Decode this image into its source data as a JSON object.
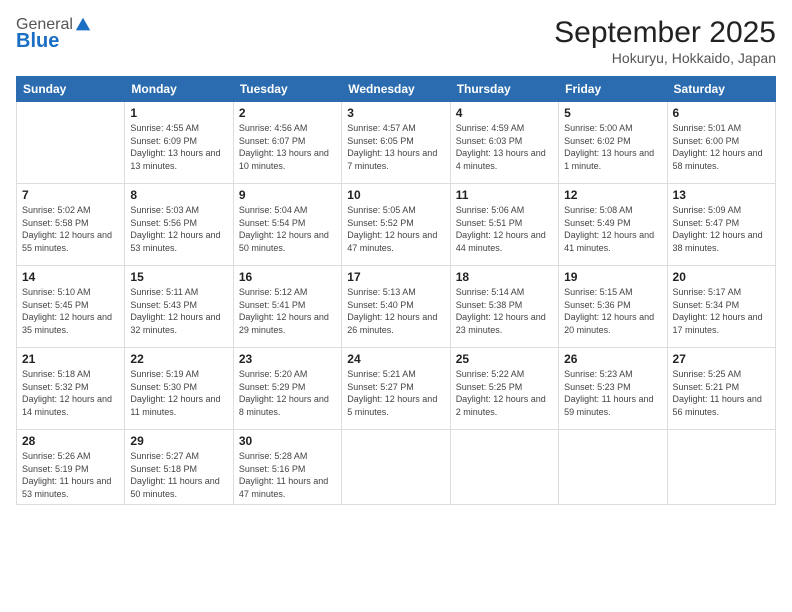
{
  "header": {
    "logo_general": "General",
    "logo_blue": "Blue",
    "month_title": "September 2025",
    "location": "Hokuryu, Hokkaido, Japan"
  },
  "days_of_week": [
    "Sunday",
    "Monday",
    "Tuesday",
    "Wednesday",
    "Thursday",
    "Friday",
    "Saturday"
  ],
  "weeks": [
    [
      {
        "day": "",
        "sunrise": "",
        "sunset": "",
        "daylight": ""
      },
      {
        "day": "1",
        "sunrise": "Sunrise: 4:55 AM",
        "sunset": "Sunset: 6:09 PM",
        "daylight": "Daylight: 13 hours and 13 minutes."
      },
      {
        "day": "2",
        "sunrise": "Sunrise: 4:56 AM",
        "sunset": "Sunset: 6:07 PM",
        "daylight": "Daylight: 13 hours and 10 minutes."
      },
      {
        "day": "3",
        "sunrise": "Sunrise: 4:57 AM",
        "sunset": "Sunset: 6:05 PM",
        "daylight": "Daylight: 13 hours and 7 minutes."
      },
      {
        "day": "4",
        "sunrise": "Sunrise: 4:59 AM",
        "sunset": "Sunset: 6:03 PM",
        "daylight": "Daylight: 13 hours and 4 minutes."
      },
      {
        "day": "5",
        "sunrise": "Sunrise: 5:00 AM",
        "sunset": "Sunset: 6:02 PM",
        "daylight": "Daylight: 13 hours and 1 minute."
      },
      {
        "day": "6",
        "sunrise": "Sunrise: 5:01 AM",
        "sunset": "Sunset: 6:00 PM",
        "daylight": "Daylight: 12 hours and 58 minutes."
      }
    ],
    [
      {
        "day": "7",
        "sunrise": "Sunrise: 5:02 AM",
        "sunset": "Sunset: 5:58 PM",
        "daylight": "Daylight: 12 hours and 55 minutes."
      },
      {
        "day": "8",
        "sunrise": "Sunrise: 5:03 AM",
        "sunset": "Sunset: 5:56 PM",
        "daylight": "Daylight: 12 hours and 53 minutes."
      },
      {
        "day": "9",
        "sunrise": "Sunrise: 5:04 AM",
        "sunset": "Sunset: 5:54 PM",
        "daylight": "Daylight: 12 hours and 50 minutes."
      },
      {
        "day": "10",
        "sunrise": "Sunrise: 5:05 AM",
        "sunset": "Sunset: 5:52 PM",
        "daylight": "Daylight: 12 hours and 47 minutes."
      },
      {
        "day": "11",
        "sunrise": "Sunrise: 5:06 AM",
        "sunset": "Sunset: 5:51 PM",
        "daylight": "Daylight: 12 hours and 44 minutes."
      },
      {
        "day": "12",
        "sunrise": "Sunrise: 5:08 AM",
        "sunset": "Sunset: 5:49 PM",
        "daylight": "Daylight: 12 hours and 41 minutes."
      },
      {
        "day": "13",
        "sunrise": "Sunrise: 5:09 AM",
        "sunset": "Sunset: 5:47 PM",
        "daylight": "Daylight: 12 hours and 38 minutes."
      }
    ],
    [
      {
        "day": "14",
        "sunrise": "Sunrise: 5:10 AM",
        "sunset": "Sunset: 5:45 PM",
        "daylight": "Daylight: 12 hours and 35 minutes."
      },
      {
        "day": "15",
        "sunrise": "Sunrise: 5:11 AM",
        "sunset": "Sunset: 5:43 PM",
        "daylight": "Daylight: 12 hours and 32 minutes."
      },
      {
        "day": "16",
        "sunrise": "Sunrise: 5:12 AM",
        "sunset": "Sunset: 5:41 PM",
        "daylight": "Daylight: 12 hours and 29 minutes."
      },
      {
        "day": "17",
        "sunrise": "Sunrise: 5:13 AM",
        "sunset": "Sunset: 5:40 PM",
        "daylight": "Daylight: 12 hours and 26 minutes."
      },
      {
        "day": "18",
        "sunrise": "Sunrise: 5:14 AM",
        "sunset": "Sunset: 5:38 PM",
        "daylight": "Daylight: 12 hours and 23 minutes."
      },
      {
        "day": "19",
        "sunrise": "Sunrise: 5:15 AM",
        "sunset": "Sunset: 5:36 PM",
        "daylight": "Daylight: 12 hours and 20 minutes."
      },
      {
        "day": "20",
        "sunrise": "Sunrise: 5:17 AM",
        "sunset": "Sunset: 5:34 PM",
        "daylight": "Daylight: 12 hours and 17 minutes."
      }
    ],
    [
      {
        "day": "21",
        "sunrise": "Sunrise: 5:18 AM",
        "sunset": "Sunset: 5:32 PM",
        "daylight": "Daylight: 12 hours and 14 minutes."
      },
      {
        "day": "22",
        "sunrise": "Sunrise: 5:19 AM",
        "sunset": "Sunset: 5:30 PM",
        "daylight": "Daylight: 12 hours and 11 minutes."
      },
      {
        "day": "23",
        "sunrise": "Sunrise: 5:20 AM",
        "sunset": "Sunset: 5:29 PM",
        "daylight": "Daylight: 12 hours and 8 minutes."
      },
      {
        "day": "24",
        "sunrise": "Sunrise: 5:21 AM",
        "sunset": "Sunset: 5:27 PM",
        "daylight": "Daylight: 12 hours and 5 minutes."
      },
      {
        "day": "25",
        "sunrise": "Sunrise: 5:22 AM",
        "sunset": "Sunset: 5:25 PM",
        "daylight": "Daylight: 12 hours and 2 minutes."
      },
      {
        "day": "26",
        "sunrise": "Sunrise: 5:23 AM",
        "sunset": "Sunset: 5:23 PM",
        "daylight": "Daylight: 11 hours and 59 minutes."
      },
      {
        "day": "27",
        "sunrise": "Sunrise: 5:25 AM",
        "sunset": "Sunset: 5:21 PM",
        "daylight": "Daylight: 11 hours and 56 minutes."
      }
    ],
    [
      {
        "day": "28",
        "sunrise": "Sunrise: 5:26 AM",
        "sunset": "Sunset: 5:19 PM",
        "daylight": "Daylight: 11 hours and 53 minutes."
      },
      {
        "day": "29",
        "sunrise": "Sunrise: 5:27 AM",
        "sunset": "Sunset: 5:18 PM",
        "daylight": "Daylight: 11 hours and 50 minutes."
      },
      {
        "day": "30",
        "sunrise": "Sunrise: 5:28 AM",
        "sunset": "Sunset: 5:16 PM",
        "daylight": "Daylight: 11 hours and 47 minutes."
      },
      {
        "day": "",
        "sunrise": "",
        "sunset": "",
        "daylight": ""
      },
      {
        "day": "",
        "sunrise": "",
        "sunset": "",
        "daylight": ""
      },
      {
        "day": "",
        "sunrise": "",
        "sunset": "",
        "daylight": ""
      },
      {
        "day": "",
        "sunrise": "",
        "sunset": "",
        "daylight": ""
      }
    ]
  ]
}
